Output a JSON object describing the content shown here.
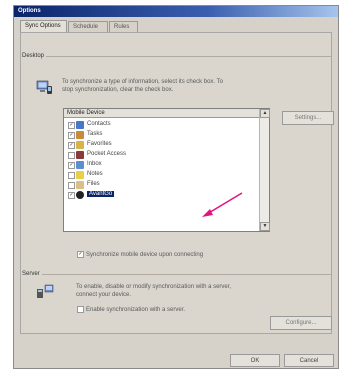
{
  "window": {
    "title": "Options"
  },
  "tabs": [
    {
      "label": "Sync Options",
      "active": true
    },
    {
      "label": "Schedule",
      "active": false
    },
    {
      "label": "Rules",
      "active": false
    }
  ],
  "desktop_group": {
    "label": "Desktop",
    "description_line1": "To synchronize a type of information, select its check box. To",
    "description_line2": "stop synchronization, clear the check box.",
    "list_header": "Mobile Device",
    "settings_button": "Settings...",
    "items": [
      {
        "label": "Contacts",
        "checked": true,
        "selected": false,
        "icon": "contacts-icon"
      },
      {
        "label": "Tasks",
        "checked": true,
        "selected": false,
        "icon": "tasks-icon"
      },
      {
        "label": "Favorites",
        "checked": true,
        "selected": false,
        "icon": "favorites-icon"
      },
      {
        "label": "Pocket Access",
        "checked": false,
        "selected": false,
        "icon": "pocket-access-icon"
      },
      {
        "label": "Inbox",
        "checked": true,
        "selected": false,
        "icon": "inbox-icon"
      },
      {
        "label": "Notes",
        "checked": false,
        "selected": false,
        "icon": "notes-icon"
      },
      {
        "label": "Files",
        "checked": false,
        "selected": false,
        "icon": "files-icon"
      },
      {
        "label": "AvantGo",
        "checked": true,
        "selected": true,
        "icon": "avantgo-icon"
      }
    ],
    "sync_on_connect_label": "Synchronize mobile device upon connecting",
    "sync_on_connect_checked": true
  },
  "server_group": {
    "label": "Server",
    "description_line1": "To enable, disable or modify synchronization with a server,",
    "description_line2": "connect your device.",
    "enable_label": "Enable synchronization with a server.",
    "enable_checked": false,
    "configure_button": "Configure..."
  },
  "footer": {
    "ok_label": "OK",
    "cancel_label": "Cancel"
  },
  "colors": {
    "title_bar": "#0a246a",
    "selection": "#0a246a",
    "annotation_arrow": "#e0157f"
  }
}
